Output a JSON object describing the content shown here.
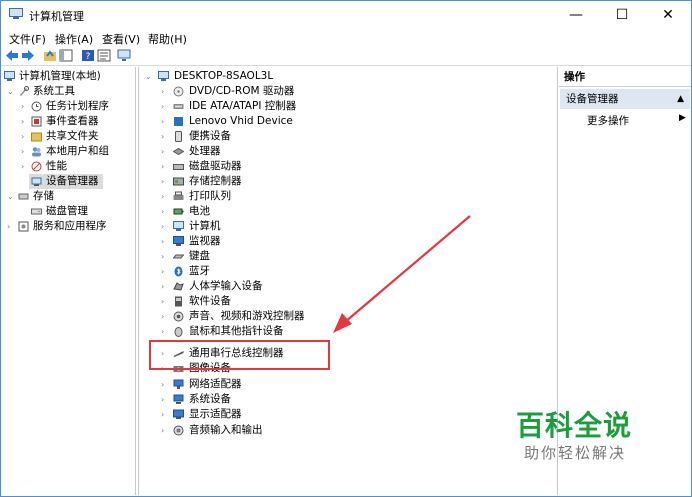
{
  "window": {
    "title": "计算机管理",
    "minimize": "—",
    "maximize": "☐",
    "close": "✕"
  },
  "menu": [
    "文件(F)",
    "操作(A)",
    "查看(V)",
    "帮助(H)"
  ],
  "left_tree": {
    "root": "计算机管理(本地)",
    "system_tools": "系统工具",
    "items": [
      "任务计划程序",
      "事件查看器",
      "共享文件夹",
      "本地用户和组",
      "性能",
      "设备管理器"
    ],
    "storage": "存储",
    "disk": "磁盘管理",
    "services": "服务和应用程序"
  },
  "device_tree": {
    "root": "DESKTOP-8SAOL3L",
    "categories": [
      "DVD/CD-ROM 驱动器",
      "IDE ATA/ATAPI 控制器",
      "Lenovo Vhid Device",
      "便携设备",
      "处理器",
      "磁盘驱动器",
      "存储控制器",
      "打印队列",
      "电池",
      "计算机",
      "监视器",
      "键盘",
      "蓝牙",
      "人体学输入设备",
      "软件设备",
      "声音、视频和游戏控制器",
      "鼠标和其他指针设备",
      "通用串行总线控制器",
      "图像设备",
      "网络适配器",
      "系统设备",
      "显示适配器",
      "音频输入和输出"
    ]
  },
  "actions": {
    "header": "操作",
    "selected": "设备管理器",
    "more": "更多操作"
  },
  "watermark": {
    "title": "百科全说",
    "subtitle": "助你轻松解决"
  },
  "colors": {
    "highlight_box": "#e2383f",
    "watermark_green": "#1a9d3c"
  }
}
